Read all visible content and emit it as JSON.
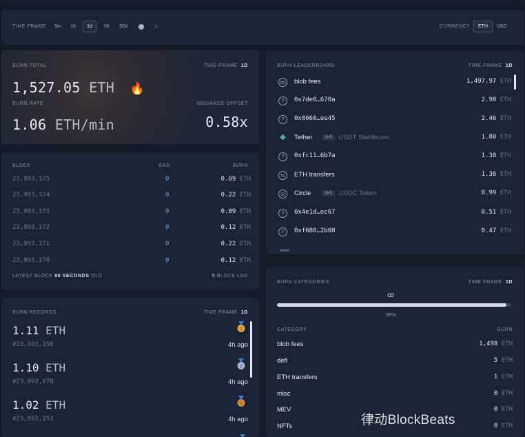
{
  "topbar": {
    "time_frame_label": "TIME FRAME",
    "options": [
      "5m",
      "1h",
      "1d",
      "7d",
      "30d",
      "merge-icon",
      "fire-icon"
    ],
    "selected": "1d",
    "currency_label": "CURRENCY",
    "currencies": [
      "ETH",
      "USD"
    ],
    "selected_currency": "ETH"
  },
  "burn_total": {
    "label": "BURN TOTAL",
    "tf_label": "TIME FRAME",
    "tf_value": "1d",
    "total_value": "1,527.05",
    "total_unit": "ETH",
    "rate_label": "BURN RATE",
    "rate_value": "1.06",
    "rate_unit": "ETH/min",
    "offset_label": "ISSUANCE OFFSET",
    "offset_value": "0.58x"
  },
  "blocks": {
    "headers": [
      "BLOCK",
      "GAS",
      "BURN"
    ],
    "rows": [
      {
        "block": "23,993,375",
        "gas": "0",
        "burn": "0.09"
      },
      {
        "block": "23,993,374",
        "gas": "0",
        "burn": "0.22"
      },
      {
        "block": "23,993,373",
        "gas": "0",
        "burn": "0.09"
      },
      {
        "block": "23,993,372",
        "gas": "0",
        "burn": "0.12"
      },
      {
        "block": "23,993,371",
        "gas": "0",
        "burn": "0.22"
      },
      {
        "block": "23,993,370",
        "gas": "0",
        "burn": "0.12"
      }
    ],
    "unit": "ETH",
    "latest_prefix": "LATEST BLOCK",
    "latest_num": "96",
    "latest_mid": "SECONDS",
    "latest_suffix": "OLD",
    "lag_num": "5",
    "lag_label": "BLOCK LAG"
  },
  "records": {
    "label": "BURN RECORDS",
    "tf_label": "TIME FRAME",
    "tf_value": "1d",
    "unit": "ETH",
    "items": [
      {
        "value": "1.11",
        "block": "#23,992,150",
        "age": "4h ago",
        "medal": "gold-medal-icon",
        "medal_color": "#e0a040"
      },
      {
        "value": "1.10",
        "block": "#23,992,078",
        "age": "4h ago",
        "medal": "silver-medal-icon",
        "medal_color": "#aab4c8"
      },
      {
        "value": "1.02",
        "block": "#23,992,153",
        "age": "4h ago",
        "medal": "bronze-medal-icon",
        "medal_color": "#d48a3c"
      }
    ]
  },
  "leaderboard": {
    "label": "BURN LEADERBOARD",
    "tf_label": "TIME FRAME",
    "tf_value": "1d",
    "unit": "ETH",
    "rows": [
      {
        "icon": "blob-icon",
        "glyph": "ꝏ",
        "name": "blob fees",
        "tag": "",
        "desc": "",
        "value": "1,497.97",
        "mono": false
      },
      {
        "icon": "unknown-icon",
        "glyph": "?",
        "name": "0x7de0…670a",
        "tag": "",
        "desc": "",
        "value": "2.90",
        "mono": true
      },
      {
        "icon": "unknown-icon",
        "glyph": "?",
        "name": "0x8660…ee45",
        "tag": "",
        "desc": "",
        "value": "2.46",
        "mono": true
      },
      {
        "icon": "tether-icon",
        "glyph": "◆",
        "name": "Tether",
        "tag": "defi",
        "desc": "USDT Stablecoin",
        "value": "1.80",
        "mono": false
      },
      {
        "icon": "unknown-icon",
        "glyph": "?",
        "name": "0xfc11…6b7a",
        "tag": "",
        "desc": "",
        "value": "1.38",
        "mono": true
      },
      {
        "icon": "transfer-icon",
        "glyph": "⇆",
        "name": "ETH transfers",
        "tag": "",
        "desc": "",
        "value": "1.36",
        "mono": false
      },
      {
        "icon": "circle-icon",
        "glyph": "◎",
        "name": "Circle",
        "tag": "defi",
        "desc": "USDC Token",
        "value": "0.99",
        "mono": false
      },
      {
        "icon": "unknown-icon",
        "glyph": "?",
        "name": "0x4e1d…ec67",
        "tag": "",
        "desc": "",
        "value": "0.51",
        "mono": true
      },
      {
        "icon": "unknown-icon",
        "glyph": "?",
        "name": "0xf680…2b08",
        "tag": "",
        "desc": "",
        "value": "0.47",
        "mono": true
      }
    ]
  },
  "categories": {
    "label": "BURN CATEGORIES",
    "tf_label": "TIME FRAME",
    "tf_value": "1d",
    "bar_fraction": 0.98,
    "bar_label": "98%",
    "col_category": "CATEGORY",
    "col_burn": "BURN",
    "unit": "ETH",
    "rows": [
      {
        "name": "blob fees",
        "value": "1,498"
      },
      {
        "name": "defi",
        "value": "5"
      },
      {
        "name": "ETH transfers",
        "value": "1"
      },
      {
        "name": "misc",
        "value": "0"
      },
      {
        "name": "MEV",
        "value": "0"
      },
      {
        "name": "NFTs",
        "value": "0"
      }
    ]
  },
  "watermark": "律动BlockBeats"
}
